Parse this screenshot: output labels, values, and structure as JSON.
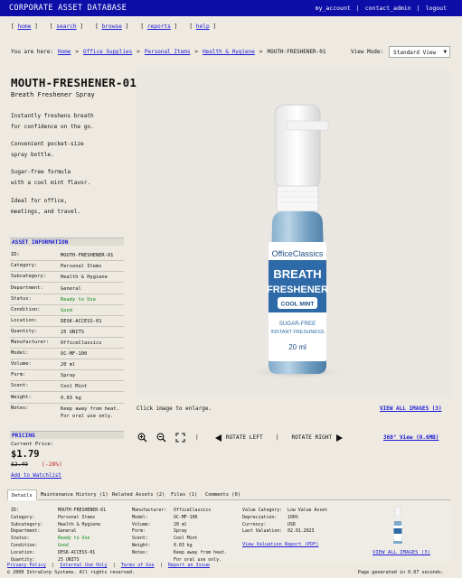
{
  "header": {
    "app_title": "CORPORATE ASSET DATABASE",
    "links": [
      "my_account",
      "contact_admin",
      "logout"
    ]
  },
  "nav": [
    "home",
    "search",
    "browse",
    "reports",
    "help"
  ],
  "breadcrumb": {
    "prefix": "You are here:",
    "items": [
      "Home",
      "Office Supplies",
      "Personal Items",
      "Health & Hygiene"
    ],
    "current": "MOUTH-FRESHENER-01"
  },
  "view_mode": {
    "label": "View Mode:",
    "value": "Standard View"
  },
  "product": {
    "title": "MOUTH-FRESHENER-01",
    "subtitle": "Breath Freshener Spray",
    "description": [
      "Instantly freshens breath\nfor confidence on the go.",
      "Convenient pocket-size\nspray bottle.",
      "Sugar-free formula\nwith a cool mint flavor.",
      "Ideal for office,\nmeetings, and travel."
    ]
  },
  "asset_info": {
    "heading": "ASSET INFORMATION",
    "rows": [
      {
        "k": "ID:",
        "v": "MOUTH-FRESHENER-01"
      },
      {
        "k": "Category:",
        "v": "Personal Items"
      },
      {
        "k": "Subcategory:",
        "v": "Health & Hygiene"
      },
      {
        "k": "Department:",
        "v": "General"
      },
      {
        "k": "Status:",
        "v": "Ready to Use"
      },
      {
        "k": "Condition:",
        "v": "Good"
      },
      {
        "k": "Location:",
        "v": "DESK-ACCESS-01"
      },
      {
        "k": "Quantity:",
        "v": "25 UNITS"
      },
      {
        "k": "Manufacturer:",
        "v": "OfficeClassics"
      },
      {
        "k": "Model:",
        "v": "OC-MF-100"
      },
      {
        "k": "Volume:",
        "v": "20 ml"
      },
      {
        "k": "Form:",
        "v": "Spray"
      },
      {
        "k": "Scent:",
        "v": "Cool Mint"
      },
      {
        "k": "Weight:",
        "v": "0.03 kg"
      },
      {
        "k": "Notes:",
        "v": "Keep away from heat.\nFor oral use only."
      }
    ]
  },
  "bottle_label": {
    "brand": "OfficeClassics",
    "line1": "BREATH",
    "line2": "FRESHENER",
    "flavor": "COOL MINT",
    "claim1": "SUGAR-FREE",
    "claim2": "INSTANT FRESHNESS",
    "volume": "20 ml"
  },
  "image_panel": {
    "enlarge_text": "Click image to enlarge.",
    "view_all": "VIEW ALL IMAGES (3)",
    "rotate_left": "ROTATE LEFT",
    "rotate_right": "ROTATE RIGHT",
    "separator": "|",
    "view_360": "360° View (0.6MB)"
  },
  "pricing": {
    "heading": "PRICING",
    "current_label": "Current Price:",
    "current": "$1.79",
    "old": "$2.49",
    "discount": "(-28%)",
    "watchlist": "Add to Watchlist"
  },
  "tabs": [
    "Details",
    "Maintenance History (1)",
    "Related Assets (2)",
    "Files (1)",
    "Comments (0)"
  ],
  "details": {
    "col1": [
      {
        "k": "ID:",
        "v": "MOUTH-FRESHENER-01"
      },
      {
        "k": "Category:",
        "v": "Personal Items"
      },
      {
        "k": "Subcategory:",
        "v": "Health & Hygiene"
      },
      {
        "k": "Department:",
        "v": "General"
      },
      {
        "k": "Status:",
        "v": "Ready to Use"
      },
      {
        "k": "Condition:",
        "v": "Good"
      },
      {
        "k": "Location:",
        "v": "DESK-ACCESS-01"
      },
      {
        "k": "Quantity:",
        "v": "25 UNITS"
      }
    ],
    "col2": [
      {
        "k": "Manufacturer:",
        "v": "OfficeClassics"
      },
      {
        "k": "Model:",
        "v": "OC-MF-100"
      },
      {
        "k": "Volume:",
        "v": "20 ml"
      },
      {
        "k": "Form:",
        "v": "Spray"
      },
      {
        "k": "Scent:",
        "v": "Cool Mint"
      },
      {
        "k": "Weight:",
        "v": "0.03 kg"
      },
      {
        "k": "Notes:",
        "v": "Keep away from heat."
      },
      {
        "k": "",
        "v": "For oral use only."
      }
    ],
    "col3": [
      {
        "k": "Value Category:",
        "v": "Low Value Asset"
      },
      {
        "k": "Depreciation:",
        "v": "100%"
      },
      {
        "k": "Currency:",
        "v": "USD"
      },
      {
        "k": "Last Valuation:",
        "v": "02.01.2023"
      }
    ],
    "valuation_link": "View Valuation Report (PDF)",
    "view_all": "VIEW ALL IMAGES (3)"
  },
  "footer": {
    "links": [
      "Privacy Policy",
      "Internal Use Only",
      "Terms of Use",
      "Report an Issue"
    ],
    "copyright": "© 2000 IntraCorp Systems. All rights reserved.",
    "generated": "Page generated in 0.07 seconds."
  },
  "colors": {
    "header_bg": "#0d0da8",
    "link": "#1a1ad6",
    "status_green": "#0c8a17",
    "discount_red": "#c21d1d",
    "page_bg": "#eeeae2"
  }
}
